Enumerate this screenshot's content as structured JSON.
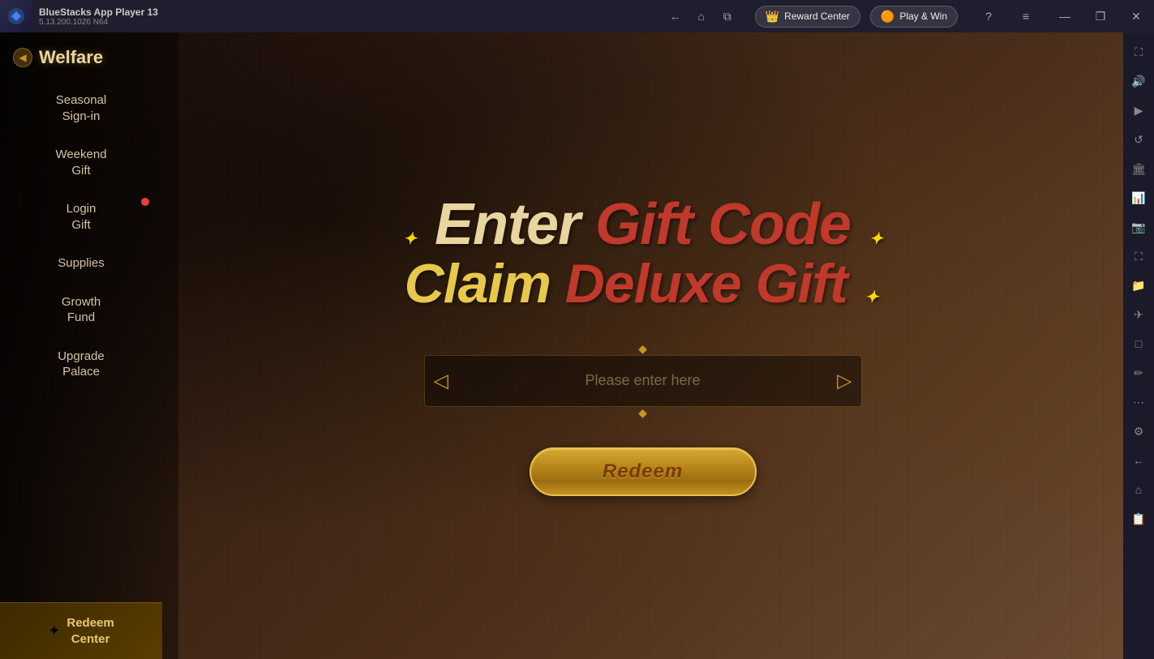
{
  "titlebar": {
    "app_name": "BlueStacks App Player 13",
    "version": "5.13.200.1026  N64",
    "back_label": "←",
    "home_label": "⌂",
    "copy_label": "⧉",
    "reward_center_label": "Reward Center",
    "play_win_label": "Play & Win",
    "help_label": "?",
    "menu_label": "≡",
    "minimize_label": "—",
    "restore_label": "❐",
    "close_label": "✕",
    "expand_label": "⛶"
  },
  "sidebar": {
    "welfare_label": "Welfare",
    "menu_items": [
      {
        "label": "Seasonal\nSign-in",
        "badge": false
      },
      {
        "label": "Weekend\nGift",
        "badge": false
      },
      {
        "label": "Login\nGift",
        "badge": true
      },
      {
        "label": "Supplies",
        "badge": false
      },
      {
        "label": "Growth\nFund",
        "badge": false
      },
      {
        "label": "Upgrade\nPalace",
        "badge": false
      }
    ],
    "redeem_center_label": "Redeem\nCenter"
  },
  "main": {
    "title_line1_part1": "Enter ",
    "title_line1_part2": "Gift Code",
    "title_line2_part1": "Claim ",
    "title_line2_part2": "Deluxe Gift",
    "input_placeholder": "Please enter here",
    "redeem_button_label": "Redeem"
  },
  "right_sidebar": {
    "buttons": [
      "⛶",
      "🔊",
      "▶",
      "↺",
      "🏛",
      "📊",
      "📷",
      "⛶",
      "📁",
      "✈",
      "□",
      "✏",
      "⋯",
      "⚙",
      "←",
      "⌂",
      "📋"
    ]
  }
}
